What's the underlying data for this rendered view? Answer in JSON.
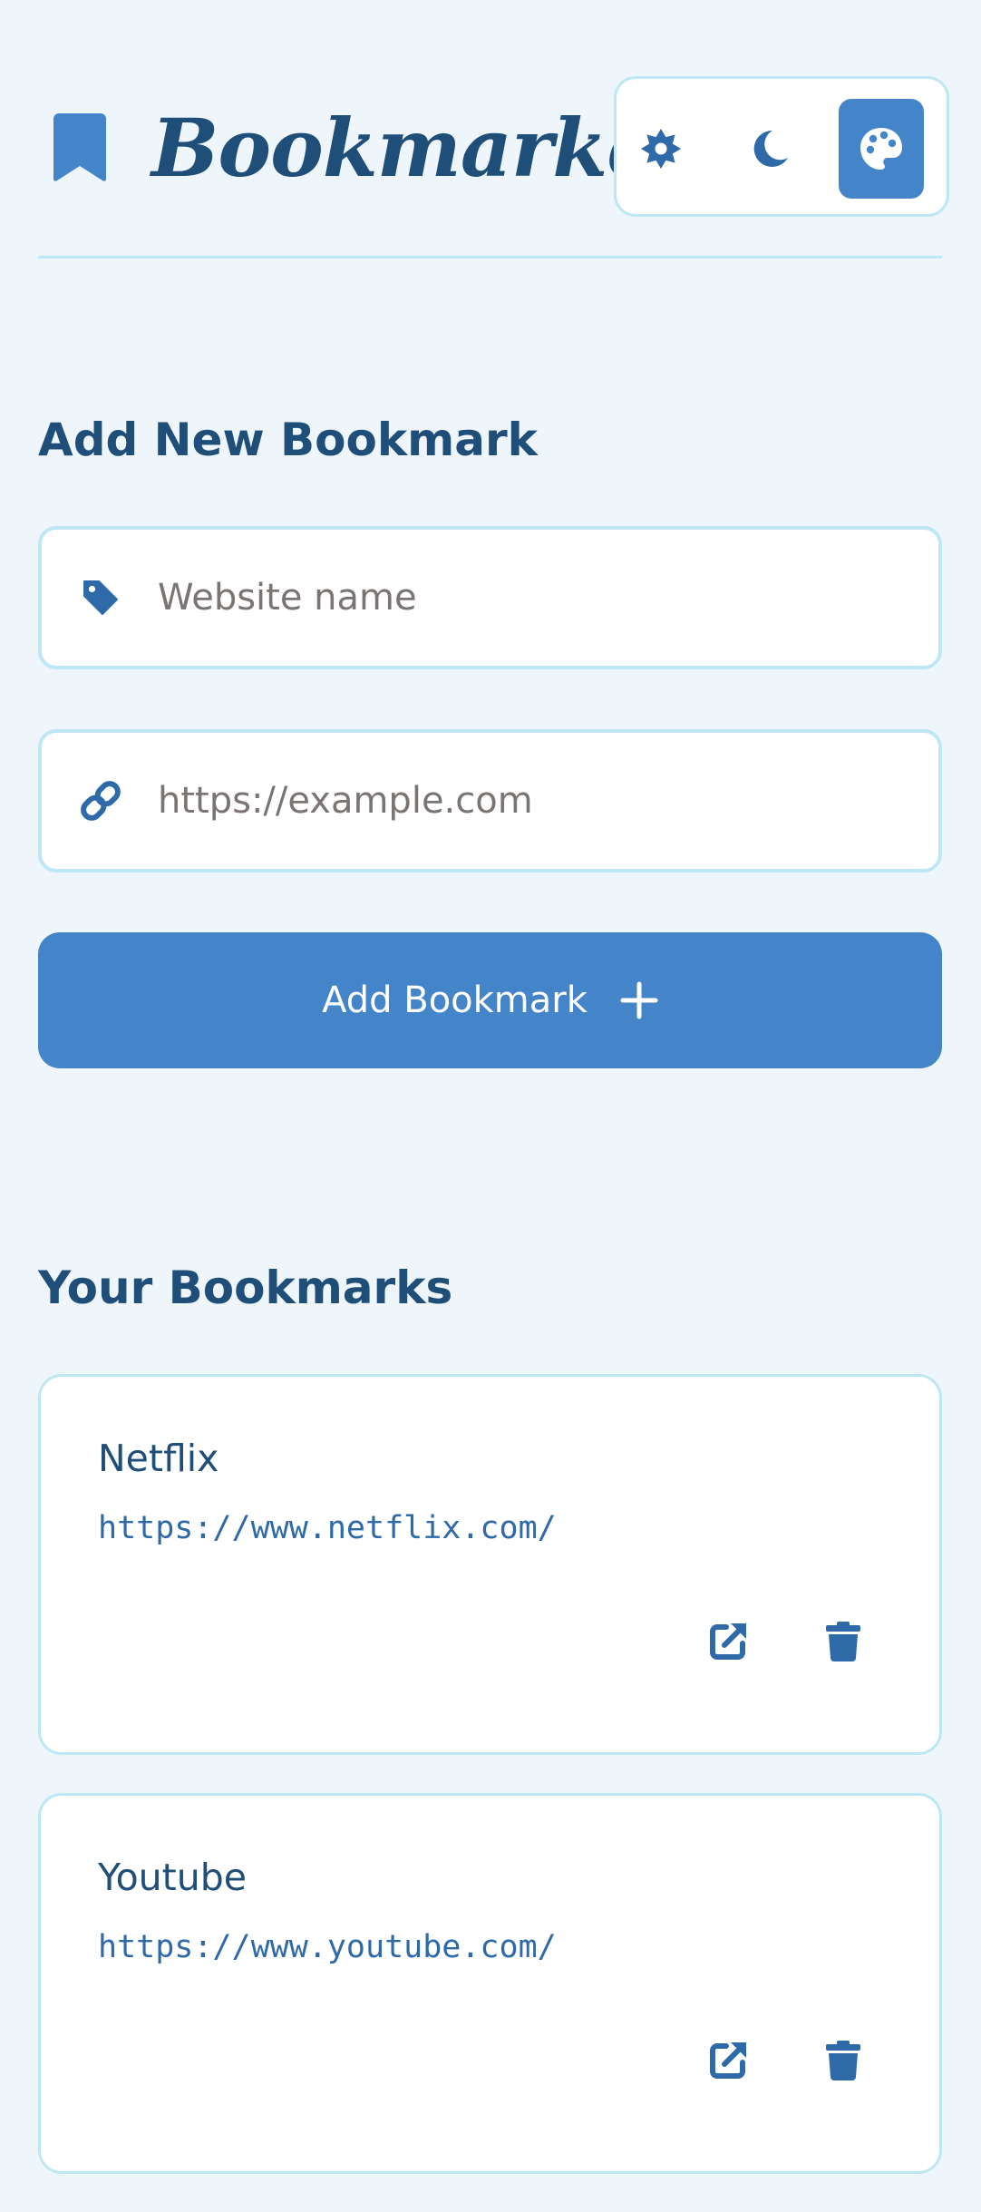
{
  "header": {
    "logo_icon": "bookmark-icon",
    "title": "Bookmarker",
    "theme_options": [
      {
        "name": "light",
        "icon": "sun-icon",
        "active": false
      },
      {
        "name": "dark",
        "icon": "moon-icon",
        "active": false
      },
      {
        "name": "color",
        "icon": "palette-icon",
        "active": true
      }
    ]
  },
  "add_section": {
    "title": "Add New Bookmark",
    "name_field": {
      "icon": "tag-icon",
      "value": "",
      "placeholder": "Website name"
    },
    "url_field": {
      "icon": "link-icon",
      "value": "",
      "placeholder": "https://example.com"
    },
    "submit_label": "Add Bookmark",
    "submit_icon": "plus-icon"
  },
  "bookmarks_section": {
    "title": "Your Bookmarks",
    "items": [
      {
        "name": "Netflix",
        "url": "https://www.netflix.com/"
      },
      {
        "name": "Youtube",
        "url": "https://www.youtube.com/"
      }
    ]
  },
  "colors": {
    "background": "#eef6fc",
    "accent": "#4485c9",
    "text": "#1f4e79",
    "icon": "#2f6aa8",
    "border": "#bde7f4"
  }
}
